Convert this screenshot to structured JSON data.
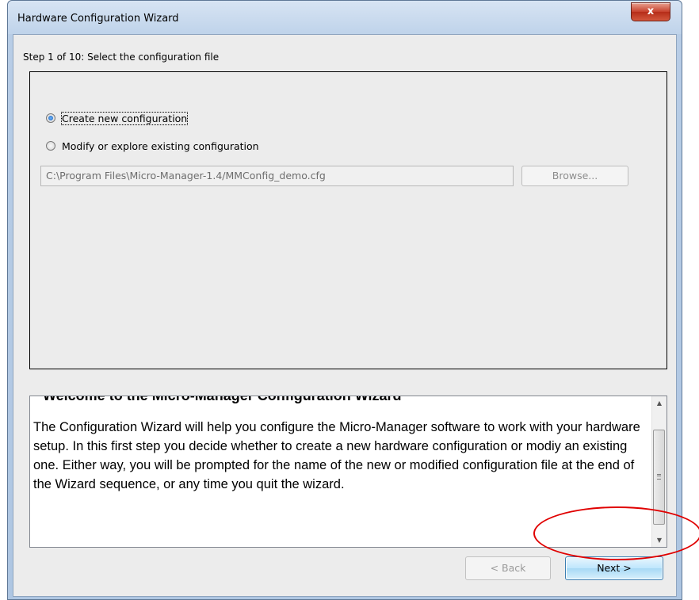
{
  "window": {
    "title": "Hardware Configuration Wizard",
    "close_glyph": "x"
  },
  "step": {
    "label": "Step 1 of 10: Select the configuration file"
  },
  "options": {
    "create_label": "Create new configuration",
    "create_selected": true,
    "modify_label": "Modify or explore existing configuration",
    "modify_selected": false
  },
  "file": {
    "path_value": "C:\\Program Files\\Micro-Manager-1.4/MMConfig_demo.cfg",
    "browse_label": "Browse..."
  },
  "description": {
    "heading": "Welcome to the Micro-Manager Configuration Wizard",
    "body": "The Configuration Wizard will help you configure the Micro-Manager software to work with your hardware setup. In this first step you decide whether to create a new hardware configuration or modiy an existing one. Either way, you will be prompted for the name of the new or modified configuration file at the end of the Wizard sequence, or any time you quit the wizard."
  },
  "nav": {
    "back_label": "< Back",
    "next_label": "Next >"
  },
  "icons": {
    "radio": "radio-button",
    "scroll_up": "scroll-up-arrow",
    "scroll_down": "scroll-down-arrow"
  },
  "colors": {
    "annotation": "#e00000",
    "next_button_border": "#3c7fb1"
  }
}
